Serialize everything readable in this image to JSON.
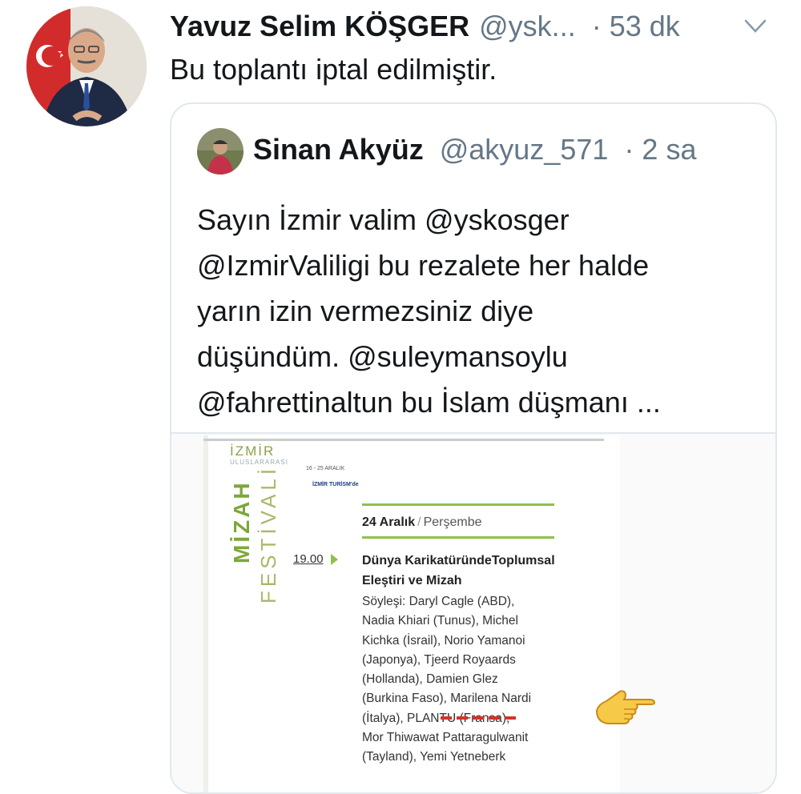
{
  "tweet": {
    "author_name": "Yavuz Selim KÖŞGER",
    "author_handle": "@ysk...",
    "time": "· 53 dk",
    "text": "Bu toplantı iptal edilmiştir."
  },
  "quoted_tweet": {
    "author_name": "Sinan Akyüz",
    "author_handle": "@akyuz_571",
    "time": "· 2 sa",
    "text_lines": [
      "Sayın İzmir valim @yskosger",
      "@IzmirValiligi bu rezalete her halde",
      "yarın izin vermezsiniz diye",
      "düşündüm. @suleymansoylu",
      "@fahrettinaltun bu İslam düşmanı ..."
    ]
  },
  "poster": {
    "city": "İZMİR",
    "subtitle": "ULUSLARARASI",
    "title": "MİZAH",
    "title2": "FESTİVALİ",
    "dates": "16 - 25 ARALIK",
    "venue": "İZMİR TURİSM'de",
    "day_date": "24 Aralık",
    "day_sep": "/",
    "day_name": "Perşembe",
    "event_time": "19.00",
    "event_title_lines": [
      "Dünya KarikatüründeToplumsal",
      "Eleştiri ve Mizah"
    ],
    "event_body_lines": [
      "Söyleşi: Daryl Cagle (ABD),",
      "Nadia Khiari (Tunus), Michel",
      "Kichka (İsrail), Norio Yamanoi",
      "(Japonya), Tjeerd Royaards",
      "(Hollanda), Damien Glez",
      "(Burkina Faso), Marilena Nardi",
      "(İtalya), PLANTU (Fransa),",
      "Mor Thiwawat Pattaragulwanit",
      "(Tayland), Yemi Yetneberk"
    ]
  },
  "colors": {
    "text": "#14171a",
    "secondary": "#657786",
    "border": "#e1e8ed",
    "poster_green": "#8fc04a",
    "highlight_dash": "#d0342c"
  },
  "icons": {
    "chevron": "chevron-down-icon",
    "pointing_hand": "pointing-hand-icon"
  }
}
